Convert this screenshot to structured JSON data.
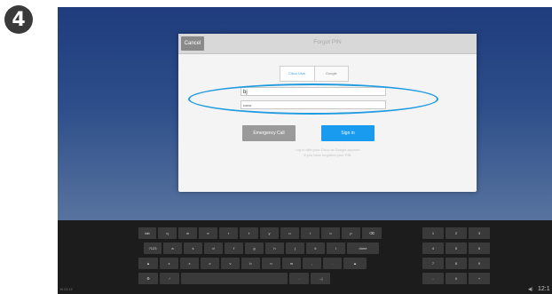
{
  "step_badge": "4",
  "dialog": {
    "cancel_label": "Cancel",
    "title": "Forgot PIN",
    "tabs": [
      {
        "label": "Cisco User"
      },
      {
        "label": "Google"
      }
    ],
    "username_value": "bj",
    "password_value": "•••••••",
    "emergency_label": "Emergency Call",
    "signin_label": "Sign in",
    "hint_line1": "Log in with your Cisco or Google account",
    "hint_line2": "if you have forgotten your PIN"
  },
  "keyboard": {
    "rows": [
      [
        "tab",
        "q",
        "w",
        "e",
        "r",
        "t",
        "y",
        "u",
        "i",
        "o",
        "p",
        "⌫"
      ],
      [
        "?123",
        "a",
        "s",
        "d",
        "f",
        "g",
        "h",
        "j",
        "k",
        "l",
        "done"
      ],
      [
        "▲",
        "z",
        "x",
        "c",
        "v",
        "b",
        "n",
        "m",
        ",",
        ".",
        "▲"
      ],
      [
        "⚙",
        "/",
        "",
        ".",
        "→|"
      ]
    ],
    "numpad": [
      [
        "1",
        "2",
        "3"
      ],
      [
        "4",
        "5",
        "6"
      ],
      [
        "7",
        "8",
        "9"
      ],
      [
        "-",
        "0",
        "+"
      ]
    ]
  },
  "status": {
    "stamp": "19.03.12",
    "volume": "◀)",
    "clock": "12:1"
  }
}
